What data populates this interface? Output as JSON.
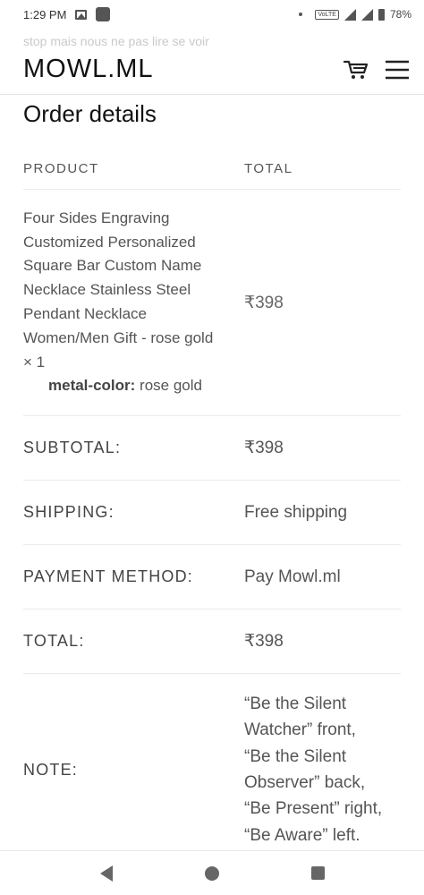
{
  "status_bar": {
    "time": "1:29 PM",
    "volte": "VoLTE",
    "battery": "78%"
  },
  "header": {
    "ghost_text": "stop mais nous ne pas lire se voir",
    "logo": "MOWL.ML"
  },
  "page": {
    "title": "Order details"
  },
  "table": {
    "headers": {
      "product": "PRODUCT",
      "total": "TOTAL"
    },
    "item": {
      "lines": [
        "Four Sides Engraving",
        "Customized Personalized",
        "Square Bar Custom Name",
        "Necklace Stainless Steel",
        "Pendant Necklace",
        "Women/Men Gift - rose gold",
        "× 1"
      ],
      "meta_key": "metal-color:",
      "meta_value": "rose gold",
      "price": "₹398"
    },
    "summary": [
      {
        "label": "SUBTOTAL:",
        "value": "₹398"
      },
      {
        "label": "SHIPPING:",
        "value": "Free shipping"
      },
      {
        "label": "PAYMENT METHOD:",
        "value": "Pay Mowl.ml"
      },
      {
        "label": "TOTAL:",
        "value": "₹398"
      }
    ],
    "note": {
      "label": "NOTE:",
      "lines": [
        "“Be the Silent",
        "Watcher” front,",
        "“Be the Silent",
        "Observer” back,",
        "“Be Present” right,",
        "“Be Aware” left."
      ]
    }
  },
  "colors": {
    "text": "#2b2b2b",
    "muted": "#555555",
    "divider": "#ebebeb"
  },
  "icons": [
    "image-icon",
    "app-icon",
    "signal-icon",
    "battery-icon",
    "cart-icon",
    "menu-icon",
    "back-icon",
    "home-icon",
    "recents-icon"
  ]
}
